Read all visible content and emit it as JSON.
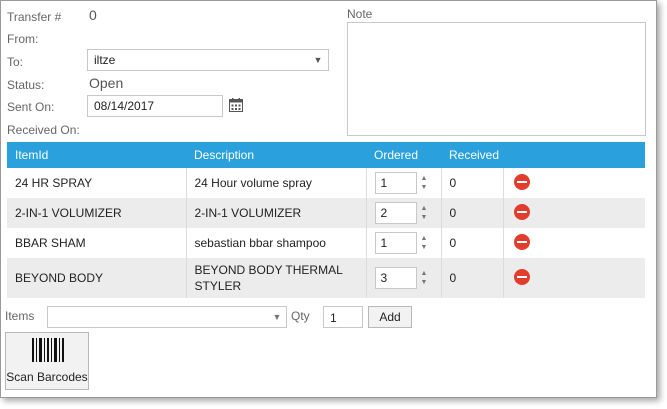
{
  "form": {
    "transfer_label": "Transfer #",
    "transfer_value": "0",
    "from_label": "From:",
    "to_label": "To:",
    "to_value": "iltze",
    "status_label": "Status:",
    "status_value": "Open",
    "sent_on_label": "Sent On:",
    "sent_on_value": "08/14/2017",
    "received_on_label": "Received On:",
    "note_label": "Note"
  },
  "grid": {
    "headers": [
      "ItemId",
      "Description",
      "Ordered",
      "Received"
    ],
    "rows": [
      {
        "item_id": "24 HR SPRAY",
        "description": "24 Hour volume spray",
        "ordered": "1",
        "received": "0"
      },
      {
        "item_id": "2-IN-1 VOLUMIZER",
        "description": "2-IN-1 VOLUMIZER",
        "ordered": "2",
        "received": "0"
      },
      {
        "item_id": "BBAR SHAM",
        "description": "sebastian bbar shampoo",
        "ordered": "1",
        "received": "0"
      },
      {
        "item_id": "BEYOND BODY",
        "description": "BEYOND BODY THERMAL STYLER",
        "ordered": "3",
        "received": "0"
      }
    ]
  },
  "add_bar": {
    "items_label": "Items",
    "items_value": "",
    "qty_label": "Qty",
    "qty_value": "1",
    "add_label": "Add"
  },
  "scan": {
    "label": "Scan Barcodes"
  },
  "icons": {
    "delete": "remove-circle-icon",
    "calendar": "calendar-icon",
    "barcode": "barcode-icon",
    "dropdown": "chevron-down-icon",
    "spinner": "spinner-arrows-icon"
  },
  "colors": {
    "header_bg": "#2aa0dc",
    "delete_red": "#e23c2c",
    "row_alt": "#ececec"
  }
}
